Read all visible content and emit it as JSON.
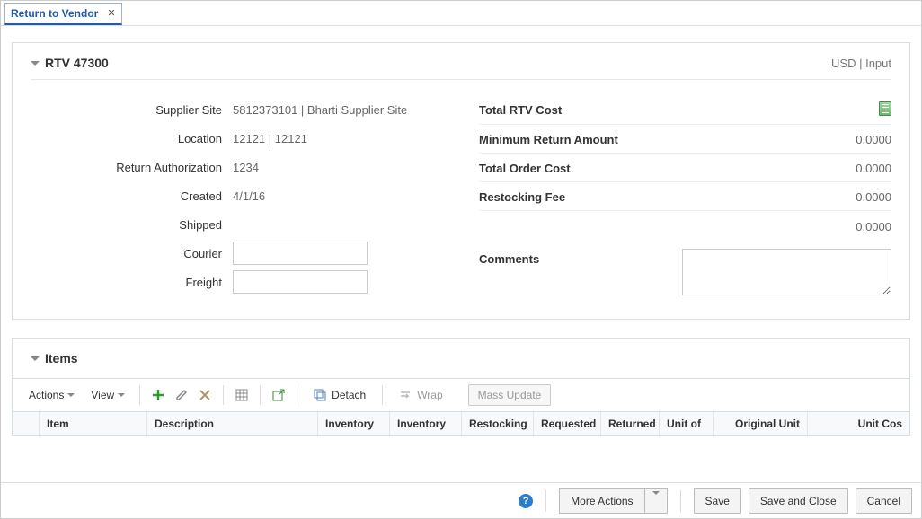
{
  "tab": {
    "label": "Return to Vendor"
  },
  "header": {
    "title": "RTV 47300",
    "subtitle": "USD | Input"
  },
  "left_fields": {
    "supplier_site": {
      "label": "Supplier Site",
      "value": "5812373101 | Bharti Supplier Site"
    },
    "location": {
      "label": "Location",
      "value": "12121 | 12121"
    },
    "return_auth": {
      "label": "Return Authorization",
      "value": "1234"
    },
    "created": {
      "label": "Created",
      "value": "4/1/16"
    },
    "shipped": {
      "label": "Shipped",
      "value": ""
    },
    "courier": {
      "label": "Courier",
      "value": ""
    },
    "freight": {
      "label": "Freight",
      "value": ""
    }
  },
  "right_fields": {
    "total_rtv_cost": {
      "label": "Total RTV Cost",
      "value": ""
    },
    "min_return_amount": {
      "label": "Minimum Return Amount",
      "value": "0.0000"
    },
    "total_order_cost": {
      "label": "Total Order Cost",
      "value": "0.0000"
    },
    "restocking_fee": {
      "label": "Restocking Fee",
      "value": "0.0000"
    },
    "blank_amount": {
      "label": "",
      "value": "0.0000"
    },
    "comments": {
      "label": "Comments",
      "value": ""
    }
  },
  "items": {
    "title": "Items",
    "toolbar": {
      "actions": "Actions",
      "view": "View",
      "detach": "Detach",
      "wrap": "Wrap",
      "mass_update": "Mass Update"
    },
    "columns": [
      "Item",
      "Description",
      "Inventory",
      "Inventory",
      "Restocking",
      "Requested",
      "Returned",
      "Unit of",
      "Original Unit",
      "Unit Cos"
    ]
  },
  "footer": {
    "more_actions": "More Actions",
    "save": "Save",
    "save_close": "Save and Close",
    "cancel": "Cancel"
  }
}
